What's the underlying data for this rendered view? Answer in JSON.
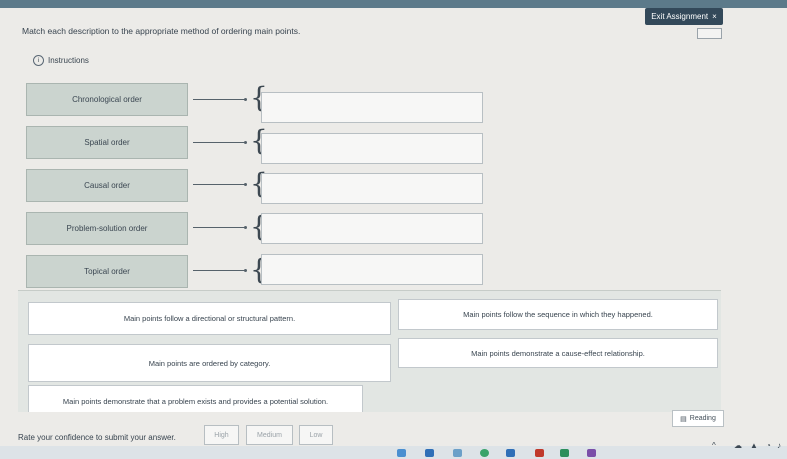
{
  "header": {
    "exit_label": "Exit Assignment",
    "exit_icon": "close-icon"
  },
  "prompt": "Match each description to the appropriate method of ordering main points.",
  "instructions_label": "Instructions",
  "methods": [
    "Chronological order",
    "Spatial order",
    "Causal order",
    "Problem-solution order",
    "Topical order"
  ],
  "descriptions": [
    "Main points follow a directional or structural pattern.",
    "Main points follow the sequence in which they happened.",
    "Main points are ordered by category.",
    "Main points demonstrate a cause-effect relationship.",
    "Main points demonstrate that a problem exists and provides a potential solution."
  ],
  "reading_label": "Reading",
  "confidence": {
    "prompt": "Rate your confidence to submit your answer.",
    "options": [
      "High",
      "Medium",
      "Low"
    ]
  },
  "colors": {
    "accent": "#33495a",
    "method_bg": "#cbd4cf",
    "pool_bg": "#e2e6e3"
  }
}
